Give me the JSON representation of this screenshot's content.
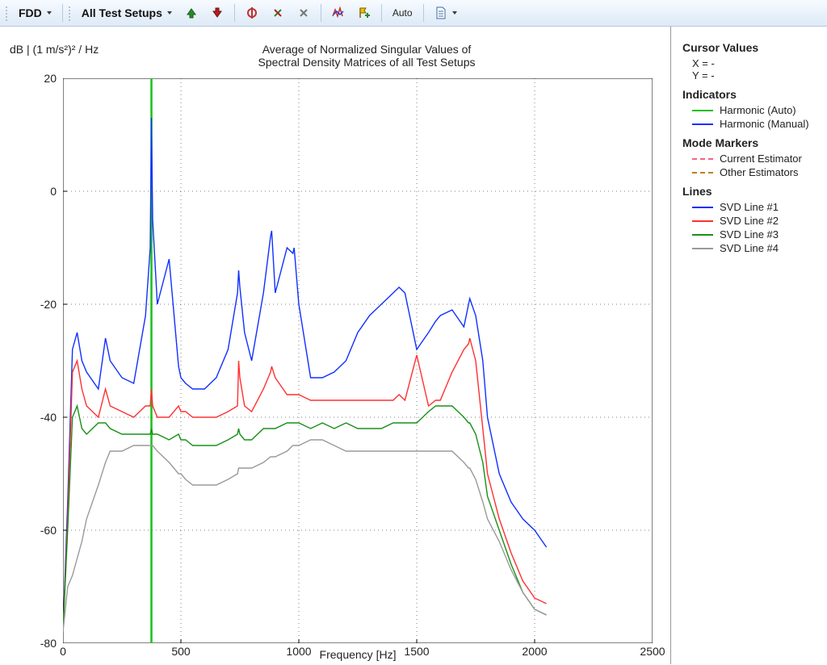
{
  "toolbar": {
    "fdd_label": "FDD",
    "all_test_setups_label": "All Test Setups",
    "auto_label": "Auto"
  },
  "chart": {
    "y_units": "dB | (1 m/s²)² / Hz",
    "title_line1": "Average of Normalized Singular Values of",
    "title_line2": "Spectral Density Matrices of all Test Setups",
    "x_label": "Frequency [Hz]"
  },
  "legend": {
    "cursor_heading": "Cursor Values",
    "cursor_x": "X = -",
    "cursor_y": "Y = -",
    "indicators_heading": "Indicators",
    "indicator_auto": "Harmonic (Auto)",
    "indicator_manual": "Harmonic (Manual)",
    "mode_heading": "Mode Markers",
    "mode_current": "Current Estimator",
    "mode_other": "Other Estimators",
    "lines_heading": "Lines",
    "line1": "SVD Line #1",
    "line2": "SVD Line #2",
    "line3": "SVD Line #3",
    "line4": "SVD Line #4"
  },
  "colors": {
    "svd1": "#1030ff",
    "svd2": "#ff3030",
    "svd3": "#189018",
    "svd4": "#9a9a9a",
    "harmonic_auto": "#18c018",
    "harmonic_manual": "#1030ff",
    "mode_current": "#ff6080",
    "mode_other": "#c08020"
  },
  "chart_data": {
    "type": "line",
    "title": "Average of Normalized Singular Values of Spectral Density Matrices of all Test Setups",
    "xlabel": "Frequency [Hz]",
    "ylabel": "dB | (1 m/s²)² / Hz",
    "xlim": [
      0,
      2500
    ],
    "ylim": [
      -80,
      20
    ],
    "x_ticks": [
      0,
      500,
      1000,
      1500,
      2000,
      2500
    ],
    "y_ticks": [
      -80,
      -60,
      -40,
      -20,
      0,
      20
    ],
    "grid": true,
    "harmonic_indicator_x": 375,
    "x": [
      0,
      20,
      40,
      60,
      80,
      100,
      150,
      180,
      200,
      250,
      300,
      350,
      370,
      375,
      380,
      400,
      450,
      490,
      500,
      520,
      550,
      600,
      650,
      700,
      740,
      745,
      750,
      770,
      800,
      850,
      880,
      885,
      900,
      950,
      975,
      980,
      1000,
      1050,
      1100,
      1150,
      1200,
      1250,
      1300,
      1350,
      1400,
      1425,
      1450,
      1500,
      1550,
      1580,
      1600,
      1650,
      1700,
      1720,
      1725,
      1750,
      1780,
      1800,
      1850,
      1900,
      1950,
      2000,
      2050
    ],
    "series": [
      {
        "name": "SVD Line #1",
        "color": "#1030ff",
        "values": [
          -78,
          -55,
          -28,
          -25,
          -30,
          -32,
          -35,
          -26,
          -30,
          -33,
          -34,
          -22,
          -10,
          13,
          -5,
          -20,
          -12,
          -31,
          -33,
          -34,
          -35,
          -35,
          -33,
          -28,
          -18,
          -14,
          -17,
          -25,
          -30,
          -18,
          -8,
          -7,
          -18,
          -10,
          -11,
          -10,
          -20,
          -33,
          -33,
          -32,
          -30,
          -25,
          -22,
          -20,
          -18,
          -17,
          -18,
          -28,
          -25,
          -23,
          -22,
          -21,
          -24,
          -20,
          -19,
          -22,
          -30,
          -40,
          -50,
          -55,
          -58,
          -60,
          -63
        ]
      },
      {
        "name": "SVD Line #2",
        "color": "#ff3030",
        "values": [
          -78,
          -58,
          -32,
          -30,
          -35,
          -38,
          -40,
          -35,
          -38,
          -39,
          -40,
          -38,
          -38,
          -35,
          -38,
          -40,
          -40,
          -38,
          -39,
          -39,
          -40,
          -40,
          -40,
          -39,
          -38,
          -30,
          -33,
          -38,
          -39,
          -35,
          -32,
          -31,
          -33,
          -36,
          -36,
          -36,
          -36,
          -37,
          -37,
          -37,
          -37,
          -37,
          -37,
          -37,
          -37,
          -36,
          -37,
          -29,
          -38,
          -37,
          -37,
          -32,
          -28,
          -27,
          -26,
          -30,
          -42,
          -50,
          -58,
          -64,
          -69,
          -72,
          -73
        ]
      },
      {
        "name": "SVD Line #3",
        "color": "#189018",
        "values": [
          -78,
          -60,
          -40,
          -38,
          -42,
          -43,
          -41,
          -41,
          -42,
          -43,
          -43,
          -43,
          -43,
          -42,
          -43,
          -43,
          -44,
          -43,
          -44,
          -44,
          -45,
          -45,
          -45,
          -44,
          -43,
          -42,
          -43,
          -44,
          -44,
          -42,
          -42,
          -42,
          -42,
          -41,
          -41,
          -41,
          -41,
          -42,
          -41,
          -42,
          -41,
          -42,
          -42,
          -42,
          -41,
          -41,
          -41,
          -41,
          -39,
          -38,
          -38,
          -38,
          -40,
          -41,
          -41,
          -43,
          -48,
          -54,
          -60,
          -66,
          -71,
          -74,
          -75
        ]
      },
      {
        "name": "SVD Line #4",
        "color": "#9a9a9a",
        "values": [
          -78,
          -70,
          -68,
          -65,
          -62,
          -58,
          -52,
          -48,
          -46,
          -46,
          -45,
          -45,
          -45,
          -45,
          -45,
          -46,
          -48,
          -50,
          -50,
          -51,
          -52,
          -52,
          -52,
          -51,
          -50,
          -49,
          -49,
          -49,
          -49,
          -48,
          -47,
          -47,
          -47,
          -46,
          -45,
          -45,
          -45,
          -44,
          -44,
          -45,
          -46,
          -46,
          -46,
          -46,
          -46,
          -46,
          -46,
          -46,
          -46,
          -46,
          -46,
          -46,
          -48,
          -49,
          -49,
          -51,
          -55,
          -58,
          -62,
          -67,
          -71,
          -74,
          -75
        ]
      }
    ]
  }
}
